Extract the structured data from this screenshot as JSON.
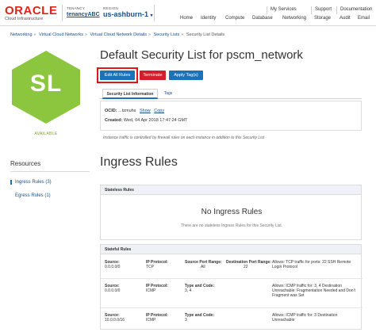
{
  "header": {
    "logo_text": "ORACLE",
    "logo_sub": "Cloud Infrastructure",
    "tenancy_label": "TENANCY",
    "tenancy_value": "tenancyABC",
    "region_label": "REGION",
    "region_value": "us-ashburn-1",
    "region_caret": "▾",
    "top_links": [
      "My Services",
      "Support",
      "Documentation"
    ],
    "nav": [
      "Home",
      "Identity",
      "Compute",
      "Database",
      "Networking",
      "Storage",
      "Audit",
      "Email"
    ]
  },
  "breadcrumb": [
    "Networking",
    "Virtual Cloud Networks",
    "Virtual Cloud Network Details",
    "Security Lists",
    "Security List Details"
  ],
  "resource_icon": {
    "initials": "SL",
    "status": "AVAILABLE",
    "color": "#8cc63f"
  },
  "title": "Default Security List for pscm_network",
  "actions": {
    "edit": "Edit All Rules",
    "terminate": "Terminate",
    "apply_tags": "Apply Tag(s)"
  },
  "tabs": [
    "Security List Information",
    "Tags"
  ],
  "info": {
    "ocid_label": "OCID:",
    "ocid_value": "...tzmuhs",
    "show": "Show",
    "copy": "Copy",
    "created_label": "Created:",
    "created_value": "Wed, 04 Apr 2018 17:47:24 GMT"
  },
  "note": "Instance traffic is controlled by firewall rules on each instance in addition to this Security List",
  "resources": {
    "title": "Resources",
    "items": [
      "Ingress Rules (3)",
      "Egress Rules (1)"
    ]
  },
  "ingress": {
    "title": "Ingress Rules",
    "stateless": {
      "header": "Stateless Rules",
      "empty_title": "No Ingress Rules",
      "empty_sub": "There are no stateless Ingress Rules for this Security List."
    },
    "stateful": {
      "header": "Stateful Rules",
      "rows": [
        {
          "source_label": "Source:",
          "source": "0.0.0.0/0",
          "proto_label": "IP Protocol:",
          "proto": "TCP",
          "mid_label": "Source Port Range:",
          "mid": "All",
          "dest_label": "Destination Port Range:",
          "dest": "22",
          "allows": "Allows: TCP traffic for ports: 22 SSH Remote Login Protocol"
        },
        {
          "source_label": "Source:",
          "source": "0.0.0.0/0",
          "proto_label": "IP Protocol:",
          "proto": "ICMP",
          "mid_label": "Type and Code:",
          "mid": "3, 4",
          "dest_label": "",
          "dest": "",
          "allows": "Allows: ICMP traffic for: 3, 4 Destination Unreachable: Fragmentation Needed and Don't Fragment was Set"
        },
        {
          "source_label": "Source:",
          "source": "10.0.0.0/16",
          "proto_label": "IP Protocol:",
          "proto": "ICMP",
          "mid_label": "Type and Code:",
          "mid": "3",
          "dest_label": "",
          "dest": "",
          "allows": "Allows: ICMP traffic for: 3 Destination Unreachable"
        }
      ]
    }
  }
}
